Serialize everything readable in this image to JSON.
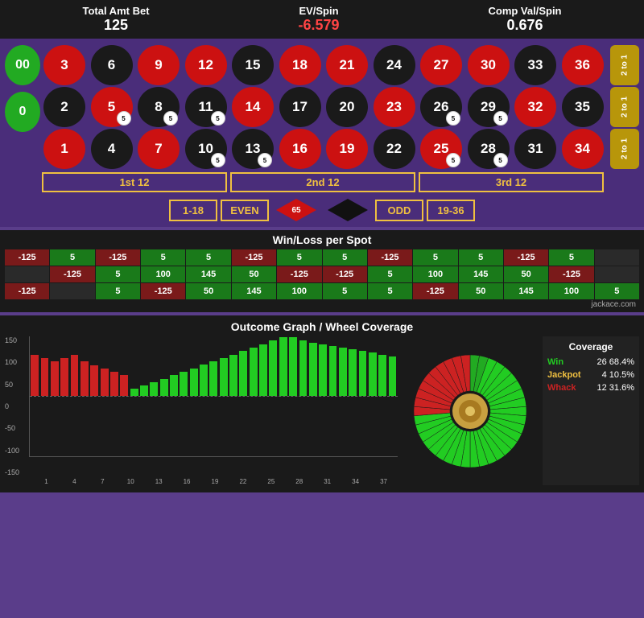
{
  "header": {
    "total_amt_label": "Total Amt Bet",
    "total_amt_value": "125",
    "ev_spin_label": "EV/Spin",
    "ev_spin_value": "-6.579",
    "comp_val_label": "Comp Val/Spin",
    "comp_val_value": "0.676"
  },
  "roulette": {
    "zeros": [
      "00",
      "0"
    ],
    "numbers": [
      {
        "n": "3",
        "c": "red"
      },
      {
        "n": "6",
        "c": "black"
      },
      {
        "n": "9",
        "c": "red"
      },
      {
        "n": "12",
        "c": "red"
      },
      {
        "n": "15",
        "c": "black"
      },
      {
        "n": "18",
        "c": "red"
      },
      {
        "n": "21",
        "c": "red"
      },
      {
        "n": "24",
        "c": "black"
      },
      {
        "n": "27",
        "c": "red"
      },
      {
        "n": "30",
        "c": "red"
      },
      {
        "n": "33",
        "c": "black"
      },
      {
        "n": "36",
        "c": "red"
      },
      {
        "n": "2",
        "c": "black"
      },
      {
        "n": "5",
        "c": "red",
        "chip": "5"
      },
      {
        "n": "8",
        "c": "black",
        "chip": "5"
      },
      {
        "n": "11",
        "c": "black",
        "chip": "5"
      },
      {
        "n": "14",
        "c": "red"
      },
      {
        "n": "17",
        "c": "black"
      },
      {
        "n": "20",
        "c": "black"
      },
      {
        "n": "23",
        "c": "red"
      },
      {
        "n": "26",
        "c": "black",
        "chip": "5"
      },
      {
        "n": "29",
        "c": "black",
        "chip": "5"
      },
      {
        "n": "32",
        "c": "red"
      },
      {
        "n": "35",
        "c": "black"
      },
      {
        "n": "1",
        "c": "red"
      },
      {
        "n": "4",
        "c": "black"
      },
      {
        "n": "7",
        "c": "red"
      },
      {
        "n": "10",
        "c": "black",
        "chip": "5"
      },
      {
        "n": "13",
        "c": "black",
        "chip": "5"
      },
      {
        "n": "16",
        "c": "red"
      },
      {
        "n": "19",
        "c": "red"
      },
      {
        "n": "22",
        "c": "black"
      },
      {
        "n": "25",
        "c": "red",
        "chip": "5"
      },
      {
        "n": "28",
        "c": "black",
        "chip": "5"
      },
      {
        "n": "31",
        "c": "black"
      },
      {
        "n": "34",
        "c": "red"
      }
    ],
    "side_labels": [
      "2 to 1",
      "2 to 1",
      "2 to 1"
    ],
    "dozens": [
      "1st 12",
      "2nd 12",
      "3rd 12"
    ],
    "bottom_bets": [
      "1-18",
      "EVEN",
      "ODD",
      "19-36"
    ],
    "red_diamond_value": "65"
  },
  "wl_table": {
    "title": "Win/Loss per Spot",
    "rows": [
      [
        "-125",
        "5",
        "-125",
        "5",
        "5",
        "-125",
        "5",
        "5",
        "-125",
        "5",
        "5",
        "-125",
        "5",
        ""
      ],
      [
        "",
        "-125",
        "5",
        "100",
        "145",
        "50",
        "-125",
        "-125",
        "5",
        "100",
        "145",
        "50",
        "-125",
        ""
      ],
      [
        "-125",
        "",
        "5",
        "-125",
        "50",
        "145",
        "100",
        "5",
        "5",
        "-125",
        "50",
        "145",
        "100",
        "5"
      ]
    ],
    "credit": "jackace.com"
  },
  "graph": {
    "title": "Outcome Graph / Wheel Coverage",
    "y_labels": [
      "150",
      "100",
      "50",
      "0",
      "-50",
      "-100",
      "-150"
    ],
    "x_labels": [
      "1",
      "4",
      "7",
      "10",
      "13",
      "16",
      "19",
      "22",
      "25",
      "28",
      "31",
      "34",
      "37"
    ],
    "bars": [
      -120,
      -110,
      -100,
      -110,
      -120,
      -100,
      -90,
      -80,
      -70,
      -60,
      20,
      30,
      40,
      50,
      60,
      70,
      80,
      90,
      100,
      110,
      120,
      130,
      140,
      150,
      160,
      170,
      170,
      160,
      155,
      150,
      145,
      140,
      135,
      130,
      125,
      120,
      115
    ],
    "coverage": {
      "title": "Coverage",
      "win_label": "Win",
      "win_count": "26",
      "win_pct": "68.4%",
      "jackpot_label": "Jackpot",
      "jackpot_count": "4",
      "jackpot_pct": "10.5%",
      "whack_label": "Whack",
      "whack_count": "12",
      "whack_pct": "31.6%"
    }
  }
}
